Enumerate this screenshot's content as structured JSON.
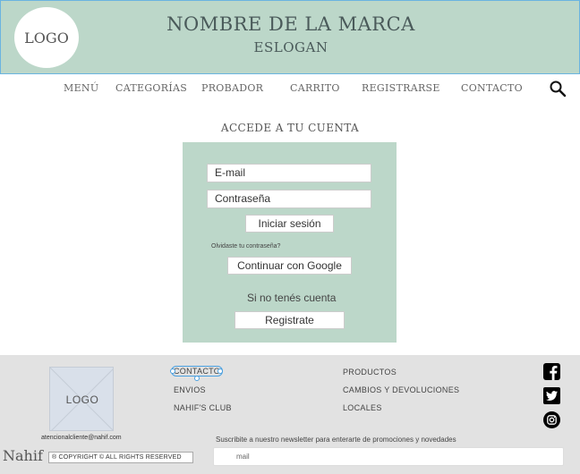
{
  "header": {
    "logo": "LOGO",
    "brand_name": "NOMBRE DE LA MARCA",
    "slogan": "ESLOGAN"
  },
  "nav": {
    "items": [
      "MENÚ",
      "CATEGORÍAS",
      "PROBADOR",
      "CARRITO",
      "REGISTRARSE",
      "CONTACTO"
    ],
    "search_icon": "search-icon"
  },
  "login": {
    "title": "ACCEDE A TU CUENTA",
    "email_placeholder": "E-mail",
    "password_placeholder": "Contraseña",
    "login_button": "Iniciar sesión",
    "forgot": "Olvidaste tu contraseña?",
    "google_button": "Continuar con Google",
    "no_account": "Si no tenés cuenta",
    "register_button": "Registrate"
  },
  "footer": {
    "logo": "LOGO",
    "email": "atencionalcliente@nahif.com",
    "col1": [
      "CONTACTO",
      "ENVIOS",
      "NAHIF'S CLUB"
    ],
    "col2": [
      "PRODUCTOS",
      "CAMBIOS Y DEVOLUCIONES",
      "LOCALES"
    ],
    "social": [
      "facebook-icon",
      "twitter-icon",
      "instagram-icon"
    ],
    "newsletter_text": "Suscribite a nuestro newsletter para enterarte de promociones y novedades",
    "mail_placeholder": "mail",
    "brand": "Nahif",
    "copyright": "® COPYRIGHT © ALL RIGHTS RESERVED"
  },
  "colors": {
    "accent_green": "#bcd7c9",
    "footer_gray": "#e2e2e2"
  }
}
